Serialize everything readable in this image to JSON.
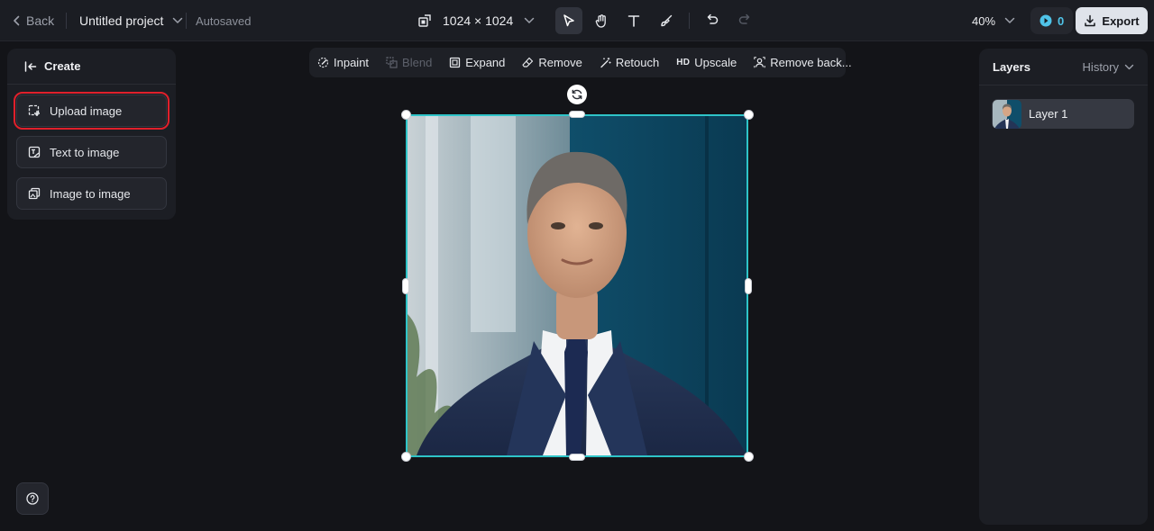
{
  "topbar": {
    "back_label": "Back",
    "project_title": "Untitled project",
    "autosave_status": "Autosaved",
    "canvas_size": "1024 × 1024",
    "zoom_level": "40%",
    "credits": "0",
    "export_label": "Export",
    "tools": [
      "select-tool",
      "hand-tool",
      "text-tool",
      "brush-tool",
      "undo",
      "redo"
    ]
  },
  "left_panel": {
    "header": "Create",
    "options": [
      {
        "label": "Upload image",
        "icon": "upload-image-icon",
        "highlighted": true
      },
      {
        "label": "Text to image",
        "icon": "text-to-image-icon"
      },
      {
        "label": "Image to image",
        "icon": "image-to-image-icon"
      }
    ]
  },
  "edit_toolbar": {
    "items": [
      {
        "label": "Inpaint",
        "icon": "inpaint-icon",
        "enabled": true
      },
      {
        "label": "Blend",
        "icon": "blend-icon",
        "enabled": false
      },
      {
        "label": "Expand",
        "icon": "expand-icon",
        "enabled": true
      },
      {
        "label": "Remove",
        "icon": "eraser-icon",
        "enabled": true
      },
      {
        "label": "Retouch",
        "icon": "retouch-icon",
        "enabled": true
      },
      {
        "label": "Upscale",
        "icon": "hd-icon",
        "icon_text": "HD",
        "enabled": true
      },
      {
        "label": "Remove back...",
        "icon": "remove-background-icon",
        "enabled": true
      }
    ]
  },
  "right_panel": {
    "layers_title": "Layers",
    "history_label": "History",
    "layers": [
      {
        "name": "Layer 1"
      }
    ]
  },
  "colors": {
    "background": "#131418",
    "panel": "#1c1e24",
    "selection": "#2ec4c8",
    "highlight_box": "#e0202b",
    "credits_accent": "#4fc3e8"
  }
}
